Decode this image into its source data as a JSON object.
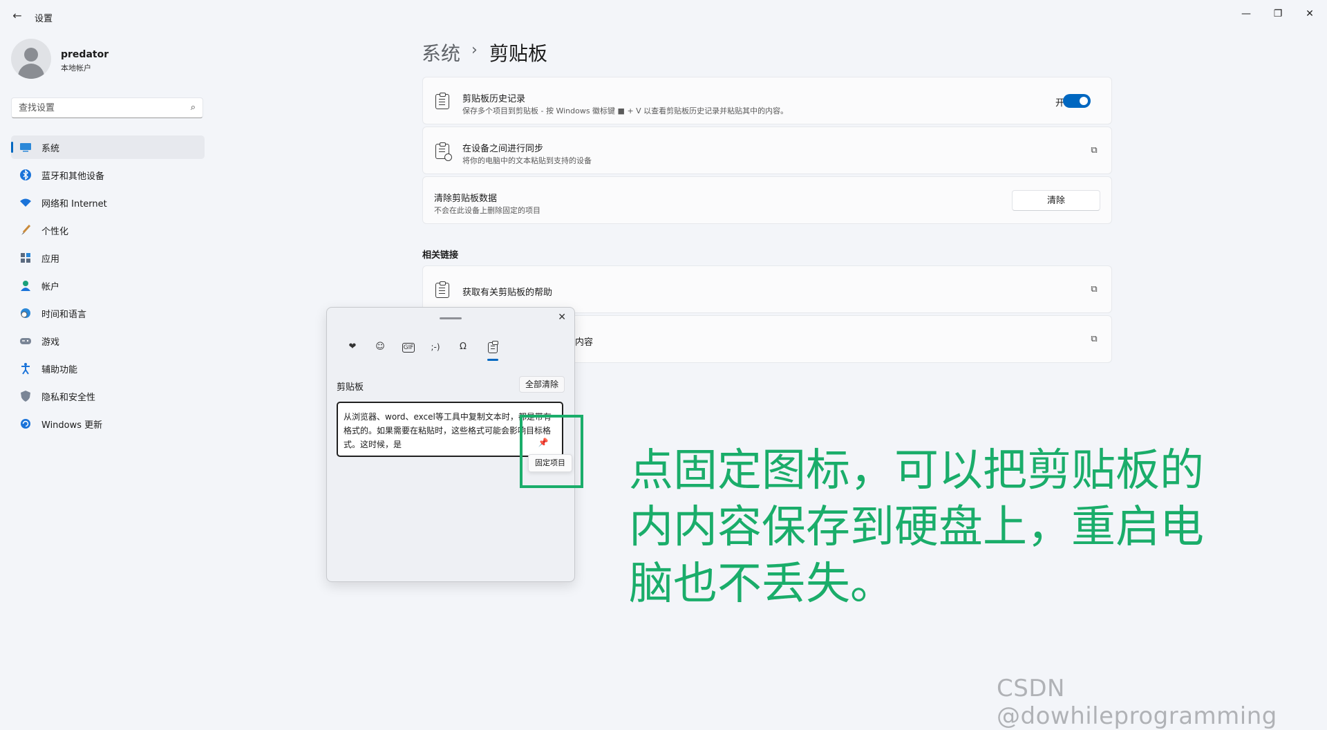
{
  "window": {
    "title": "设置",
    "controls": [
      "—",
      "❐",
      "✕"
    ]
  },
  "profile": {
    "name": "predator",
    "account_type": "本地帐户"
  },
  "search": {
    "placeholder": "查找设置"
  },
  "nav": [
    {
      "label": "系统",
      "icon": "monitor-icon",
      "active": true
    },
    {
      "label": "蓝牙和其他设备",
      "icon": "bluetooth-icon"
    },
    {
      "label": "网络和 Internet",
      "icon": "wifi-icon"
    },
    {
      "label": "个性化",
      "icon": "brush-icon"
    },
    {
      "label": "应用",
      "icon": "apps-icon"
    },
    {
      "label": "帐户",
      "icon": "person-icon"
    },
    {
      "label": "时间和语言",
      "icon": "globe-clock-icon"
    },
    {
      "label": "游戏",
      "icon": "gamepad-icon"
    },
    {
      "label": "辅助功能",
      "icon": "accessibility-icon"
    },
    {
      "label": "隐私和安全性",
      "icon": "shield-icon"
    },
    {
      "label": "Windows 更新",
      "icon": "update-icon"
    }
  ],
  "header": {
    "parent": "系统",
    "separator": "›",
    "current": "剪贴板"
  },
  "settings": {
    "history": {
      "title": "剪贴板历史记录",
      "subtitle": "保存多个项目到剪贴板 - 按 Windows 徽标键 ■ + V 以查看剪贴板历史记录并粘贴其中的内容。",
      "toggle_label": "开",
      "toggle_on": true
    },
    "sync": {
      "title": "在设备之间进行同步",
      "subtitle": "将你的电脑中的文本粘贴到支持的设备"
    },
    "clear": {
      "title": "清除剪贴板数据",
      "subtitle": "不会在此设备上删除固定的项目",
      "button": "清除"
    }
  },
  "related": {
    "title": "相关链接",
    "links": [
      {
        "label": "获取有关剪贴板的帮助"
      },
      {
        "label": "内容"
      }
    ]
  },
  "flyout": {
    "tabs": [
      "❤",
      "☺",
      "GIF",
      ";-)",
      "Ω",
      "clip"
    ],
    "label": "剪贴板",
    "clear_all": "全部清除",
    "item_text": "从浏览器、word、excel等工具中复制文本时，都是带有格式的。如果需要在粘贴时，这些格式可能会影响目标格式。这时候，是",
    "pin_tooltip": "固定项目"
  },
  "annotation": "点固定图标，可以把剪贴板的内内容保存到硬盘上，重启电脑也不丢失。",
  "watermark": "CSDN @dowhileprogramming",
  "colors": {
    "accent": "#0067c0",
    "annotation": "#1aad6a",
    "background": "#f3f5f9"
  }
}
